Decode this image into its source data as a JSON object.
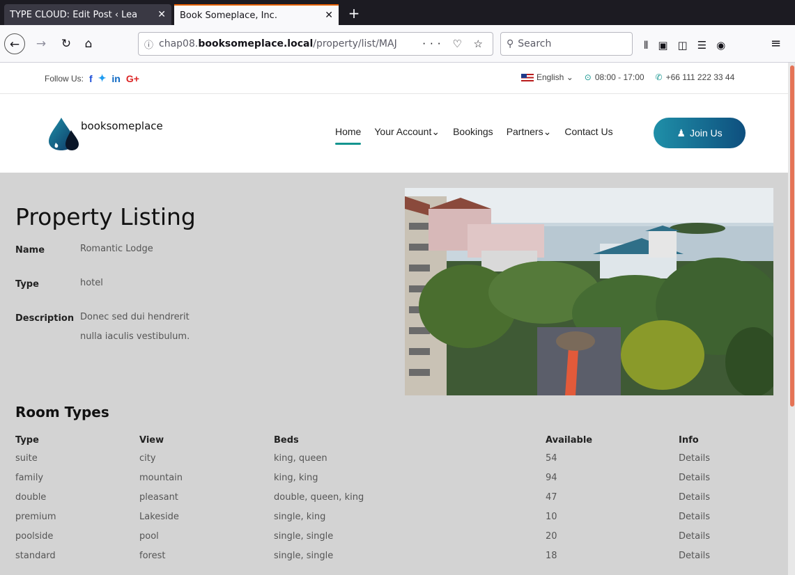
{
  "browser": {
    "tabs": [
      {
        "title": "TYPE CLOUD: Edit Post ‹ Lea",
        "close": "✕"
      },
      {
        "title": "Book Someplace, Inc.",
        "close": "✕"
      }
    ],
    "new_tab": "+",
    "url_prefix": "chap08.",
    "url_domain": "booksomeplace.local",
    "url_path": "/property/list/MAJ",
    "url_icons": "··· ♡ ☆",
    "search_placeholder": "Search"
  },
  "topbar": {
    "follow_label": "Follow Us:",
    "social": [
      "f",
      "🐦",
      "in",
      "G+"
    ],
    "language": "English ⌄",
    "hours": "08:00 - 17:00",
    "phone": "+66 111 222 33 44"
  },
  "header": {
    "logo_text": "booksomeplace",
    "nav": [
      {
        "label": "Home",
        "active": true
      },
      {
        "label": "Your Account⌄",
        "active": false
      },
      {
        "label": "Bookings",
        "active": false
      },
      {
        "label": "Partners⌄",
        "active": false
      },
      {
        "label": "Contact Us",
        "active": false
      }
    ],
    "join_label": "Join Us"
  },
  "property": {
    "title": "Property Listing",
    "name_label": "Name",
    "name_value": "Romantic Lodge",
    "type_label": "Type",
    "type_value": "hotel",
    "description_label": "Description",
    "description_value": "Donec sed dui hendrerit nulla iaculis vestibulum."
  },
  "rooms": {
    "title": "Room Types",
    "headers": [
      "Type",
      "View",
      "Beds",
      "Available",
      "Info"
    ],
    "rows": [
      [
        "suite",
        "city",
        "king, queen",
        "54",
        "Details"
      ],
      [
        "family",
        "mountain",
        "king, king",
        "94",
        "Details"
      ],
      [
        "double",
        "pleasant",
        "double, queen, king",
        "47",
        "Details"
      ],
      [
        "premium",
        "Lakeside",
        "single, king",
        "10",
        "Details"
      ],
      [
        "poolside",
        "pool",
        "single, single",
        "20",
        "Details"
      ],
      [
        "standard",
        "forest",
        "single, single",
        "18",
        "Details"
      ]
    ]
  },
  "colors": {
    "accent": "#14958f",
    "join_gradient_start": "#1f8fa8",
    "join_gradient_end": "#0e4f7e",
    "page_bg": "#d3d3d3"
  },
  "icons": {
    "back": "back-arrow-icon",
    "forward": "forward-arrow-icon",
    "reload": "reload-icon",
    "home": "home-icon",
    "info": "info-icon",
    "clock": "clock-icon",
    "phone": "phone-icon",
    "join": "user-icon"
  }
}
